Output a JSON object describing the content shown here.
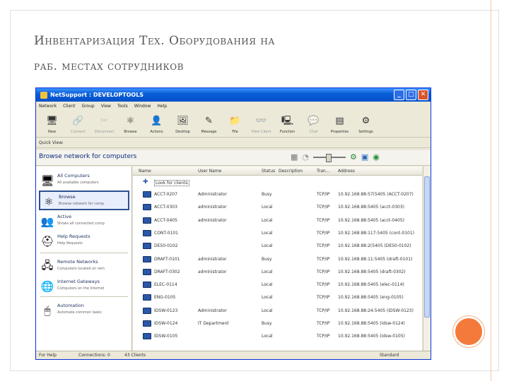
{
  "slide": {
    "title_line1": "Инвентаризация Тех. Оборудования на",
    "title_line2": "раб. местах сотрудников"
  },
  "window": {
    "title": "NetSupport : DEVELOPTOOLS",
    "controls": [
      "_",
      "□",
      "✕"
    ]
  },
  "menu": [
    "Network",
    "Client",
    "Group",
    "View",
    "Tools",
    "Window",
    "Help"
  ],
  "toolbar": [
    {
      "label": "New",
      "icon": "new-icon",
      "glyph": "🖥",
      "dim": false
    },
    {
      "label": "Connect",
      "icon": "connect-icon",
      "glyph": "🔗",
      "dim": true
    },
    {
      "label": "Disconnect",
      "icon": "disconnect-icon",
      "glyph": "✂",
      "dim": true
    },
    {
      "label": "Browse",
      "icon": "browse-icon",
      "glyph": "⚛",
      "dim": false
    },
    {
      "label": "Actions",
      "icon": "actions-icon",
      "glyph": "👤",
      "dim": false
    },
    {
      "label": "Desktop",
      "icon": "desktop-icon",
      "glyph": "🖼",
      "dim": false
    },
    {
      "label": "Message",
      "icon": "message-icon",
      "glyph": "✎",
      "dim": false
    },
    {
      "label": "File",
      "icon": "file-icon",
      "glyph": "📁",
      "dim": false
    },
    {
      "label": "View Client",
      "icon": "view-client-icon",
      "glyph": "👓",
      "dim": true
    },
    {
      "label": "Function",
      "icon": "function-icon",
      "glyph": "🖳",
      "dim": false
    },
    {
      "label": "Chat",
      "icon": "chat-icon",
      "glyph": "💬",
      "dim": true
    },
    {
      "label": "Properties",
      "icon": "properties-icon",
      "glyph": "▤",
      "dim": false
    },
    {
      "label": "Settings",
      "icon": "settings-icon",
      "glyph": "⚙",
      "dim": false
    }
  ],
  "quickview_label": "Quick View:",
  "browse_title": "Browse network for computers",
  "left_panel": [
    {
      "label": "All Computers",
      "desc": "All available computers",
      "icon": "monitor-icon",
      "glyph": "🖥",
      "selected": false
    },
    {
      "label": "Browse",
      "desc": "Browse network for comp",
      "icon": "browse-atom-icon",
      "glyph": "⚛",
      "selected": true
    },
    {
      "label": "Active",
      "desc": "Shows all connected comp",
      "icon": "active-computers-icon",
      "glyph": "👥",
      "selected": false
    },
    {
      "label": "Help Requests",
      "desc": "Help Requests",
      "icon": "lifebuoy-icon",
      "glyph": "⛑",
      "selected": false
    },
    {
      "label": "Remote Networks",
      "desc": "Computers located on rem",
      "icon": "remote-networks-icon",
      "glyph": "🖧",
      "selected": false
    },
    {
      "label": "Internet Gateways",
      "desc": "Computers on the Internet",
      "icon": "globe-icon",
      "glyph": "🌐",
      "selected": false
    },
    {
      "label": "Automation",
      "desc": "Automate common tasks",
      "icon": "automation-icon",
      "glyph": "🖱",
      "selected": false
    }
  ],
  "list": {
    "columns": [
      "Name",
      "User Name",
      "Status",
      "Description",
      "Tran...",
      "Address"
    ],
    "add_row": "Look for clients",
    "rows": [
      [
        "ACCT-0207",
        "Administrator",
        "Busy",
        "",
        "TCP/IP",
        "10.92.168.88:57(5405 (ACCT-0207)"
      ],
      [
        "ACCT-0303",
        "administrator",
        "Local",
        "",
        "TCP/IP",
        "10.92.168.88:5405 (acct-0303)"
      ],
      [
        "ACCT-0405",
        "administrator",
        "Local",
        "",
        "TCP/IP",
        "10.92.168.88:5405 (acct-0405)"
      ],
      [
        "CONT-0101",
        "",
        "Local",
        "",
        "TCP/IP",
        "10.92.168.88:117:5405 (cont-0101)"
      ],
      [
        "DES0-0102",
        "",
        "Local",
        "",
        "TCP/IP",
        "10.92.168.88:2(5405 (DES0-0102)"
      ],
      [
        "DRAFT-0101",
        "administrator",
        "Busy",
        "",
        "TCP/IP",
        "10.92.168.88:11:5405 (draft-0101)"
      ],
      [
        "DRAFT-0302",
        "administrator",
        "Local",
        "",
        "TCP/IP",
        "10.92.168.88:5405 (draft-0302)"
      ],
      [
        "ELEC-0114",
        "",
        "Local",
        "",
        "TCP/IP",
        "10.92.168.88:5405 (elec-0114)"
      ],
      [
        "ENG-0105",
        "",
        "Local",
        "",
        "TCP/IP",
        "10.92.168.88:5405 (eng-0105)"
      ],
      [
        "IDSW-0123",
        "Administrator",
        "Local",
        "",
        "TCP/IP",
        "10.92.168.88:24:5405 (IDSW-0123)"
      ],
      [
        "IDSW-0124",
        "IT Department",
        "Busy",
        "",
        "TCP/IP",
        "10.92.168.88:5405 (idsw-0124)"
      ],
      [
        "IDSW-0105",
        "",
        "Local",
        "",
        "TCP/IP",
        "10.92.168.88:5405 (idsw-0105)"
      ]
    ]
  },
  "status": {
    "help": "For Help",
    "connections_label": "Connections: 0",
    "clients": "43 Clients",
    "mode": "Standard"
  }
}
